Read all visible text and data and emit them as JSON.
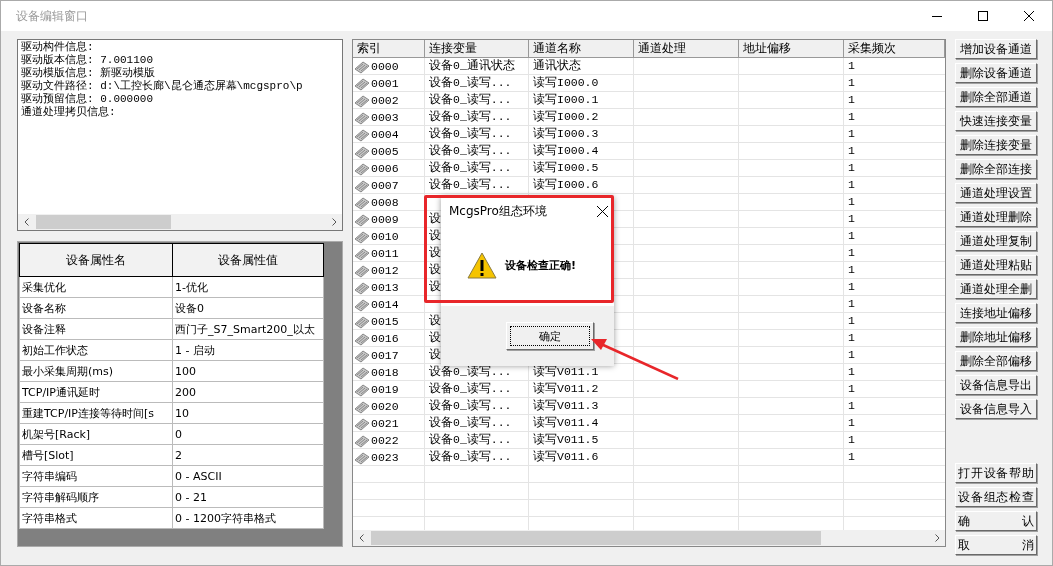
{
  "window": {
    "title": "设备编辑窗口"
  },
  "driver_info": {
    "lines": [
      "驱动构件信息:",
      "驱动版本信息: 7.001100",
      "驱动模版信息: 新驱动模版",
      "驱动文件路径: d:\\工控长廊\\昆仑通态屏幕\\mcgspro\\p",
      "驱动预留信息: 0.000000",
      "通道处理拷贝信息:"
    ]
  },
  "properties": {
    "columns": [
      "设备属性名",
      "设备属性值"
    ],
    "rows": [
      {
        "name": "采集优化",
        "value": "1-优化"
      },
      {
        "name": "设备名称",
        "value": "设备0"
      },
      {
        "name": "设备注释",
        "value": "西门子_S7_Smart200_以太"
      },
      {
        "name": "初始工作状态",
        "value": "1 - 启动"
      },
      {
        "name": "最小采集周期(ms)",
        "value": "100"
      },
      {
        "name": "TCP/IP通讯延时",
        "value": "200"
      },
      {
        "name": "重建TCP/IP连接等待时间[s",
        "value": "10"
      },
      {
        "name": "机架号[Rack]",
        "value": "0"
      },
      {
        "name": "槽号[Slot]",
        "value": "2"
      },
      {
        "name": "字符串编码",
        "value": "0 - ASCII"
      },
      {
        "name": "字符串解码顺序",
        "value": "0 - 21"
      },
      {
        "name": "字符串格式",
        "value": "0 - 1200字符串格式"
      }
    ]
  },
  "channels": {
    "columns": [
      "索引",
      "连接变量",
      "通道名称",
      "通道处理",
      "地址偏移",
      "采集频次"
    ],
    "rows": [
      {
        "index": "0000",
        "variable": "设备0_通讯状态",
        "name": "通讯状态",
        "frequency": "1"
      },
      {
        "index": "0001",
        "variable": "设备0_读写...",
        "name": "读写I000.0",
        "frequency": "1"
      },
      {
        "index": "0002",
        "variable": "设备0_读写...",
        "name": "读写I000.1",
        "frequency": "1"
      },
      {
        "index": "0003",
        "variable": "设备0_读写...",
        "name": "读写I000.2",
        "frequency": "1"
      },
      {
        "index": "0004",
        "variable": "设备0_读写...",
        "name": "读写I000.3",
        "frequency": "1"
      },
      {
        "index": "0005",
        "variable": "设备0_读写...",
        "name": "读写I000.4",
        "frequency": "1"
      },
      {
        "index": "0006",
        "variable": "设备0_读写...",
        "name": "读写I000.5",
        "frequency": "1"
      },
      {
        "index": "0007",
        "variable": "设备0_读写...",
        "name": "读写I000.6",
        "frequency": "1"
      },
      {
        "index": "0008",
        "frequency": "1"
      },
      {
        "index": "0009",
        "variable": "设",
        "frequency": "1"
      },
      {
        "index": "0010",
        "variable": "设",
        "frequency": "1"
      },
      {
        "index": "0011",
        "variable": "设",
        "frequency": "1"
      },
      {
        "index": "0012",
        "variable": "设",
        "frequency": "1"
      },
      {
        "index": "0013",
        "variable": "设",
        "frequency": "1"
      },
      {
        "index": "0014",
        "frequency": "1"
      },
      {
        "index": "0015",
        "variable": "设",
        "frequency": "1"
      },
      {
        "index": "0016",
        "variable": "设",
        "frequency": "1"
      },
      {
        "index": "0017",
        "variable": "设",
        "frequency": "1"
      },
      {
        "index": "0018",
        "variable": "设备0_读写...",
        "name": "读写V011.1",
        "frequency": "1"
      },
      {
        "index": "0019",
        "variable": "设备0_读写...",
        "name": "读写V011.2",
        "frequency": "1"
      },
      {
        "index": "0020",
        "variable": "设备0_读写...",
        "name": "读写V011.3",
        "frequency": "1"
      },
      {
        "index": "0021",
        "variable": "设备0_读写...",
        "name": "读写V011.4",
        "frequency": "1"
      },
      {
        "index": "0022",
        "variable": "设备0_读写...",
        "name": "读写V011.5",
        "frequency": "1"
      },
      {
        "index": "0023",
        "variable": "设备0_读写...",
        "name": "读写V011.6",
        "frequency": "1"
      }
    ]
  },
  "side_buttons": [
    "增加设备通道",
    "删除设备通道",
    "删除全部通道",
    "快速连接变量",
    "删除连接变量",
    "删除全部连接",
    "通道处理设置",
    "通道处理删除",
    "通道处理复制",
    "通道处理粘贴",
    "通道处理全删",
    "连接地址偏移",
    "删除地址偏移",
    "删除全部偏移",
    "设备信息导出",
    "设备信息导入"
  ],
  "bottom_buttons": [
    "打开设备帮助",
    "设备组态检查",
    "确 认",
    "取 消"
  ],
  "dialog": {
    "title": "McgsPro组态环境",
    "message": "设备检查正确!",
    "button": "确定"
  }
}
